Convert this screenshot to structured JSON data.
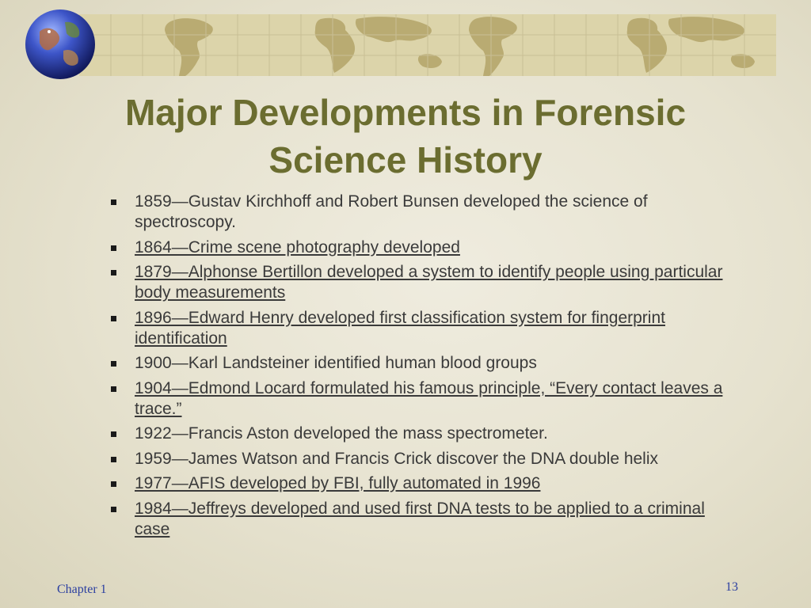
{
  "slide": {
    "title_line1": "Major Developments in Forensic",
    "title_line2": "Science History",
    "bullets": [
      {
        "text": "1859—Gustav Kirchhoff and Robert Bunsen developed the science of spectroscopy.",
        "link": false
      },
      {
        "text": "1864—Crime scene photography developed",
        "link": true
      },
      {
        "text": "1879—Alphonse Bertillon developed a system to identify people using particular body measurements",
        "link": true
      },
      {
        "text": "1896—Edward Henry developed first classification system for fingerprint identification",
        "link": true
      },
      {
        "text": "1900—Karl Landsteiner identified human blood groups",
        "link": false
      },
      {
        "text": "1904—Edmond Locard formulated his famous principle, “Every contact leaves a trace.”",
        "link": true
      },
      {
        "text": "1922—Francis Aston developed the mass spectrometer.",
        "link": false
      },
      {
        "text": "1959—James Watson and Francis Crick discover the DNA double helix",
        "link": false
      },
      {
        "text": "1977—AFIS developed by FBI, fully automated in 1996",
        "link": true
      },
      {
        "text": "1984—Jeffreys developed and used first DNA tests to be applied to a criminal case",
        "link": true
      }
    ],
    "footer_left": "Chapter 1",
    "page_number": "13"
  },
  "colors": {
    "title": "#6b6d30",
    "footer": "#2b3fa0",
    "banner": "#dcd4aa",
    "continents": "#b8a970"
  },
  "icons": {
    "globe": "globe-icon",
    "world_map": "world-map-banner"
  }
}
